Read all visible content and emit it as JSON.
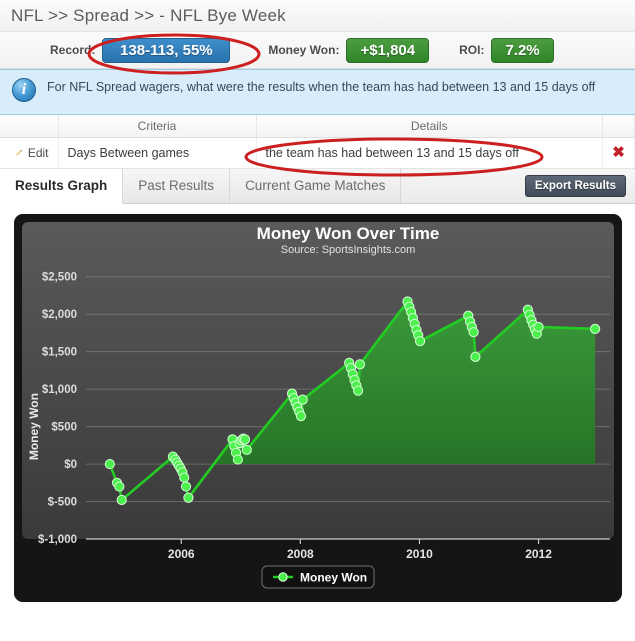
{
  "window": {
    "title": "NFL >> Spread >> - NFL Bye Week"
  },
  "stats": {
    "record_label": "Record:",
    "record_value": "138-113, 55%",
    "money_won_label": "Money Won:",
    "money_won_value": "+$1,804",
    "roi_label": "ROI:",
    "roi_value": "7.2%",
    "record_color": "#2a73ad",
    "money_color": "#31852a",
    "roi_color": "#31852a"
  },
  "info": {
    "icon": "info-icon",
    "text": "For NFL Spread wagers, what were the results when the team has had between 13 and 15 days off"
  },
  "criteria_table": {
    "columns": [
      "",
      "Criteria",
      "Details",
      ""
    ],
    "rows": [
      {
        "edit_label": "Edit",
        "criteria": "Days Between games",
        "details": "the team has had between 13 and 15 days off",
        "delete_label": "✖"
      }
    ]
  },
  "tabs": [
    {
      "label": "Results Graph",
      "active": true
    },
    {
      "label": "Past Results",
      "active": false
    },
    {
      "label": "Current Game Matches",
      "active": false
    }
  ],
  "toolbar": {
    "export_label": "Export Results"
  },
  "annotations": {
    "ellipse_record": "red-ellipse-around-record",
    "ellipse_details": "red-ellipse-around-details"
  },
  "chart_data": {
    "type": "area",
    "title": "Money Won Over Time",
    "subtitle": "Source: SportsInsights.com",
    "xlabel": "",
    "ylabel": "Money Won",
    "legend": [
      "Money Won"
    ],
    "legend_position": "bottom",
    "grid": true,
    "line_color": "#22cc22",
    "marker_color": "#4cf04c",
    "fill_color": "#2f7a2f",
    "plot_bg": "#4a4a4a",
    "panel_bg": "#151515",
    "xlim": [
      2004.4,
      2013.2
    ],
    "ylim": [
      -1000,
      2750
    ],
    "xticks": [
      2006,
      2008,
      2010,
      2012
    ],
    "xticklabels": [
      "2006",
      "2008",
      "2010",
      "2012"
    ],
    "yticks": [
      -1000,
      -500,
      0,
      500,
      1000,
      1500,
      2000,
      2500
    ],
    "yticklabels": [
      "$-1,000",
      "$-500",
      "$0",
      "$500",
      "$1,000",
      "$1,500",
      "$2,000",
      "$2,500"
    ],
    "series": [
      {
        "name": "Money Won",
        "x": [
          2004.8,
          2004.92,
          2004.96,
          2005.0,
          2005.86,
          2005.9,
          2005.93,
          2005.96,
          2005.99,
          2006.02,
          2006.05,
          2006.08,
          2006.12,
          2006.86,
          2006.89,
          2006.92,
          2006.95,
          2006.98,
          2007.01,
          2007.04,
          2007.07,
          2007.1,
          2007.86,
          2007.89,
          2007.92,
          2007.95,
          2007.98,
          2008.01,
          2008.04,
          2008.82,
          2008.85,
          2008.88,
          2008.91,
          2008.94,
          2008.97,
          2009.0,
          2009.8,
          2009.83,
          2009.86,
          2009.89,
          2009.92,
          2009.95,
          2009.98,
          2010.01,
          2010.82,
          2010.85,
          2010.88,
          2010.91,
          2010.94,
          2011.82,
          2011.85,
          2011.88,
          2011.91,
          2011.94,
          2011.97,
          2012.0,
          2012.95
        ],
        "y": [
          0,
          -250,
          -300,
          -480,
          100,
          60,
          20,
          -20,
          -60,
          -110,
          -180,
          -300,
          -450,
          330,
          240,
          150,
          60,
          280,
          320,
          340,
          330,
          190,
          940,
          880,
          820,
          760,
          700,
          640,
          860,
          1350,
          1280,
          1200,
          1120,
          1050,
          980,
          1330,
          2170,
          2100,
          2030,
          1950,
          1870,
          1790,
          1720,
          1640,
          1980,
          1900,
          1830,
          1760,
          1430,
          2060,
          1990,
          1920,
          1860,
          1800,
          1740,
          1830,
          1804
        ]
      }
    ]
  }
}
